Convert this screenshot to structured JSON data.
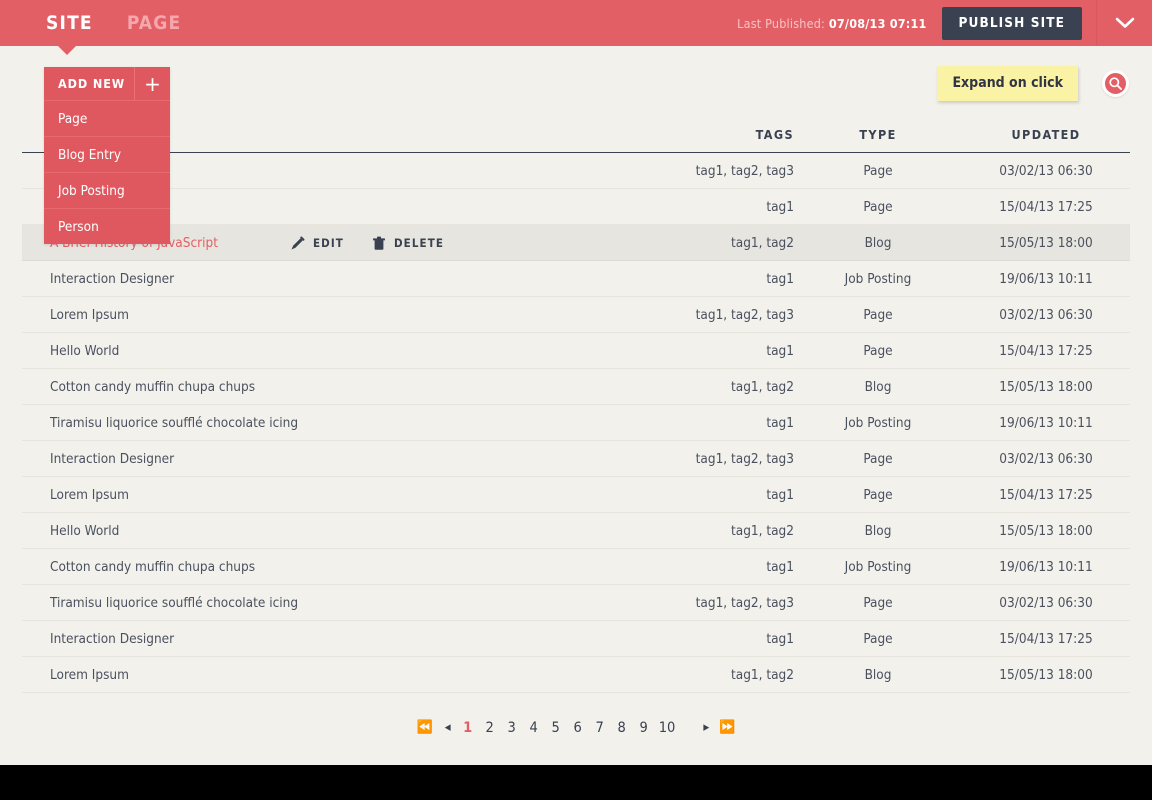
{
  "topbar": {
    "tabs": [
      {
        "label": "SITE",
        "active": true
      },
      {
        "label": "PAGE",
        "active": false
      }
    ],
    "published_label": "Last Published:",
    "published_value": "07/08/13 07:11",
    "publish_button": "PUBLISH SITE",
    "toggle_icon": "chevron-down-icon",
    "accent_color": "#E35F66",
    "dark_color": "#3A4150"
  },
  "add_new": {
    "header_label": "ADD NEW",
    "plus_icon": "plus-icon",
    "items": [
      {
        "label": "Page"
      },
      {
        "label": "Blog Entry"
      },
      {
        "label": "Job Posting"
      },
      {
        "label": "Person"
      }
    ]
  },
  "tooltip": {
    "text": "Expand on click",
    "background": "#FAF2A4"
  },
  "search": {
    "icon": "search-icon"
  },
  "table": {
    "columns": [
      "",
      "TAGS",
      "TYPE",
      "UPDATED"
    ],
    "row_actions": [
      {
        "label": "EDIT",
        "icon": "pencil-icon"
      },
      {
        "label": "DELETE",
        "icon": "trash-icon"
      }
    ],
    "rows": [
      {
        "title": "",
        "tags": "tag1, tag2, tag3",
        "type": "Page",
        "updated": "03/02/13 06:30",
        "hover": false
      },
      {
        "title": "",
        "tags": "tag1",
        "type": "Page",
        "updated": "15/04/13 17:25",
        "hover": false
      },
      {
        "title": "A Brief History of JavaScript",
        "tags": "tag1, tag2",
        "type": "Blog",
        "updated": "15/05/13 18:00",
        "hover": true
      },
      {
        "title": "Interaction Designer",
        "tags": "tag1",
        "type": "Job Posting",
        "updated": "19/06/13 10:11",
        "hover": false
      },
      {
        "title": "Lorem Ipsum",
        "tags": "tag1, tag2, tag3",
        "type": "Page",
        "updated": "03/02/13 06:30",
        "hover": false
      },
      {
        "title": "Hello World",
        "tags": "tag1",
        "type": "Page",
        "updated": "15/04/13 17:25",
        "hover": false
      },
      {
        "title": "Cotton candy muffin chupa chups",
        "tags": "tag1, tag2",
        "type": "Blog",
        "updated": "15/05/13 18:00",
        "hover": false
      },
      {
        "title": "Tiramisu liquorice soufflé chocolate icing",
        "tags": "tag1",
        "type": "Job Posting",
        "updated": "19/06/13 10:11",
        "hover": false
      },
      {
        "title": "Interaction Designer",
        "tags": "tag1, tag2, tag3",
        "type": "Page",
        "updated": "03/02/13 06:30",
        "hover": false
      },
      {
        "title": "Lorem Ipsum",
        "tags": "tag1",
        "type": "Page",
        "updated": "15/04/13 17:25",
        "hover": false
      },
      {
        "title": "Hello World",
        "tags": "tag1, tag2",
        "type": "Blog",
        "updated": "15/05/13 18:00",
        "hover": false
      },
      {
        "title": "Cotton candy muffin chupa chups",
        "tags": "tag1",
        "type": "Job Posting",
        "updated": "19/06/13 10:11",
        "hover": false
      },
      {
        "title": "Tiramisu liquorice soufflé chocolate icing",
        "tags": "tag1, tag2, tag3",
        "type": "Page",
        "updated": "03/02/13 06:30",
        "hover": false
      },
      {
        "title": "Interaction Designer",
        "tags": "tag1",
        "type": "Page",
        "updated": "15/04/13 17:25",
        "hover": false
      },
      {
        "title": "Lorem Ipsum",
        "tags": "tag1, tag2",
        "type": "Blog",
        "updated": "15/05/13 18:00",
        "hover": false
      }
    ]
  },
  "pagination": {
    "first_icon": "first-page-icon",
    "prev_icon": "prev-page-icon",
    "next_icon": "next-page-icon",
    "last_icon": "last-page-icon",
    "pages": [
      "1",
      "2",
      "3",
      "4",
      "5",
      "6",
      "7",
      "8",
      "9",
      "10"
    ],
    "current": "1"
  }
}
